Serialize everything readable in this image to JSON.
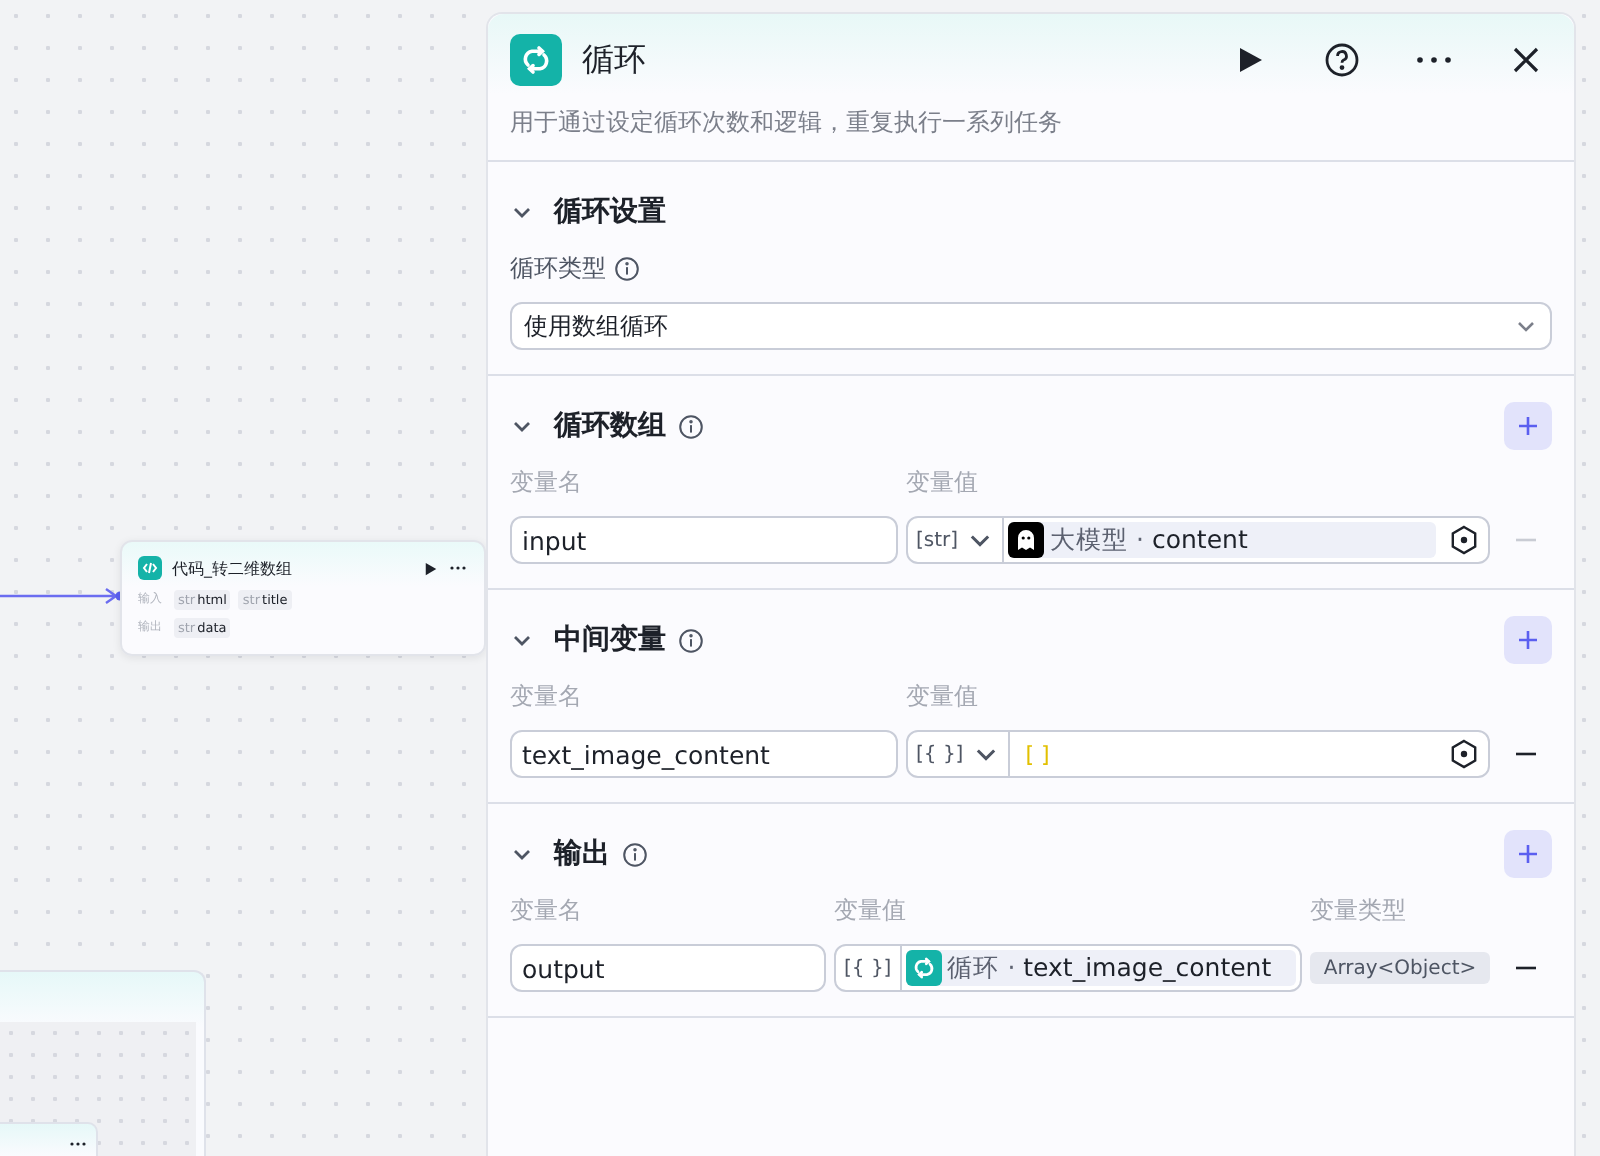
{
  "canvas": {
    "nodes": [
      {
        "kind": "code",
        "title": "代码_转二维数组",
        "inputs_label": "输入",
        "inputs": [
          {
            "type": "str",
            "name": "html"
          },
          {
            "type": "str",
            "name": "title"
          }
        ],
        "outputs_label": "输出",
        "outputs": [
          {
            "type": "str",
            "name": "data"
          }
        ]
      }
    ]
  },
  "panel": {
    "title": "循环",
    "description": "用于通过设定循环次数和逻辑，重复执行一系列任务",
    "sections": [
      {
        "kind": "select",
        "title": "循环设置",
        "expanded": true,
        "info": false,
        "field_label": "循环类型",
        "field_info": true,
        "value": "使用数组循环"
      },
      {
        "kind": "variables",
        "title": "循环数组",
        "expanded": true,
        "info": true,
        "columns": [
          "变量名",
          "变量值"
        ],
        "rows": [
          {
            "name": "input",
            "type": "[str]",
            "dropdown": true,
            "value": {
              "kind": "model_ref",
              "source": "大模型 ·",
              "field": "content"
            },
            "picker": true,
            "remove_disabled": true
          }
        ]
      },
      {
        "kind": "variables",
        "title": "中间变量",
        "expanded": true,
        "info": true,
        "columns": [
          "变量名",
          "变量值"
        ],
        "rows": [
          {
            "name": "text_image_content",
            "type": "[{ }]",
            "dropdown": true,
            "value": {
              "kind": "literal",
              "text": "[ ]"
            },
            "picker": true,
            "remove_disabled": false
          }
        ]
      },
      {
        "kind": "variables",
        "title": "输出",
        "expanded": true,
        "info": true,
        "columns": [
          "变量名",
          "变量值",
          "变量类型"
        ],
        "rows": [
          {
            "name": "output",
            "type": "[{ }]",
            "dropdown": false,
            "value": {
              "kind": "loop_ref",
              "source": "循环 ·",
              "field": "text_image_content"
            },
            "picker": false,
            "var_type": "Array<Object>",
            "remove_disabled": false
          }
        ]
      }
    ]
  }
}
